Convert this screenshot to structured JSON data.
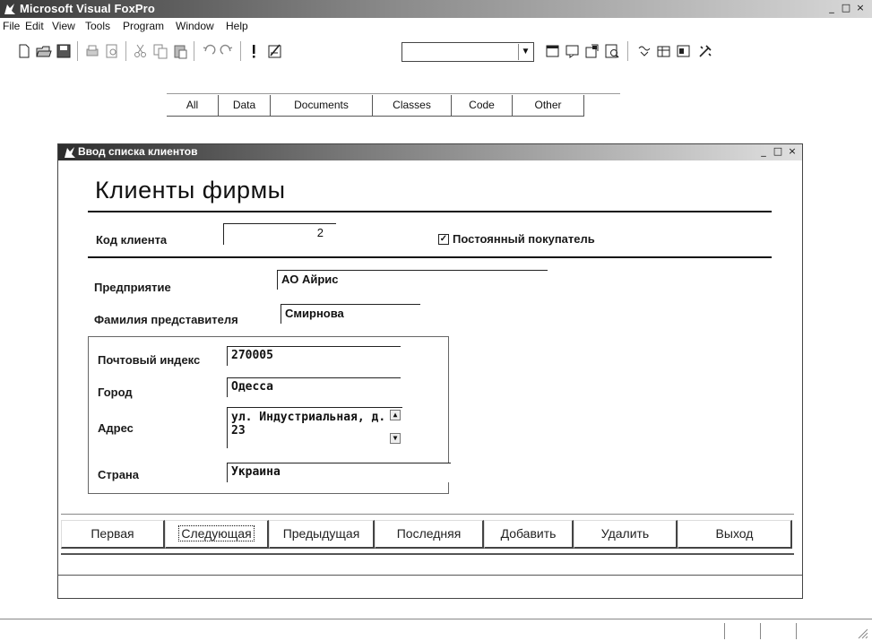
{
  "app": {
    "title": "Microsoft Visual FoxPro",
    "controls": {
      "minimize": "_",
      "maximize": "□",
      "close": "×"
    }
  },
  "menu": [
    "File",
    "Edit",
    "View",
    "Tools",
    "Program",
    "Window",
    "Help"
  ],
  "toolbar": {
    "icons": [
      "new-file-icon",
      "open-folder-icon",
      "save-icon",
      "print-icon",
      "print-preview-icon",
      "cut-icon",
      "copy-icon",
      "paste-icon",
      "undo-icon",
      "redo-icon",
      "run-icon",
      "modify-form-icon",
      "command-window-icon",
      "view-window-icon",
      "properties-icon",
      "form-designer-icon",
      "connections-icon",
      "data-session-icon",
      "code-window-icon",
      "wizard-icon"
    ],
    "combo_value": ""
  },
  "project_tabs": [
    "All",
    "Data",
    "Documents",
    "Classes",
    "Code",
    "Other"
  ],
  "form": {
    "title": "Ввод списка клиентов",
    "heading": "Клиенты фирмы",
    "client_code_label": "Код клиента",
    "client_code_value": "2",
    "regular_customer_label": "Постоянный покупатель",
    "regular_customer_checked": true,
    "company_label": "Предприятие",
    "company_value": "АО Айрис",
    "rep_label": "Фамилия представителя",
    "rep_value": "Смирнова",
    "zip_label": "Почтовый индекс",
    "zip_value": "270005",
    "city_label": "Город",
    "city_value": "Одесса",
    "address_label": "Адрес",
    "address_value": "ул. Индустриальная, д. 23",
    "country_label": "Страна",
    "country_value": "Украина",
    "buttons": [
      "Первая",
      "Следующая",
      "Предыдущая",
      "Последняя",
      "Добавить",
      "Удалить",
      "Выход"
    ]
  }
}
